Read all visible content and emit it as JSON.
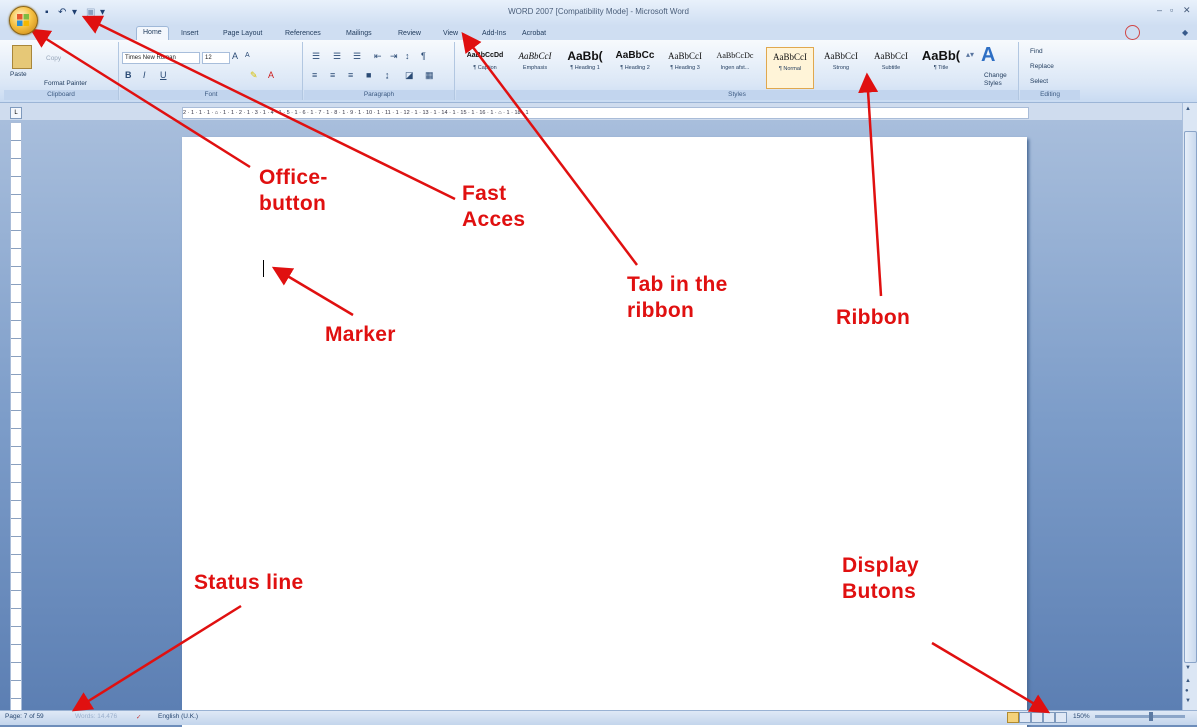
{
  "window": {
    "title": "WORD 2007 [Compatibility Mode] - Microsoft Word",
    "controls": [
      "–",
      "▫",
      "✕"
    ]
  },
  "quick_access": {
    "save": "💾",
    "undo": "↶",
    "redo": "▾",
    "customize": "▾"
  },
  "tabs": [
    {
      "label": "Home"
    },
    {
      "label": "Insert"
    },
    {
      "label": "Page Layout"
    },
    {
      "label": "References"
    },
    {
      "label": "Mailings"
    },
    {
      "label": "Review"
    },
    {
      "label": "View"
    },
    {
      "label": "Add-Ins"
    },
    {
      "label": "Acrobat"
    }
  ],
  "ribbon": {
    "clipboard": {
      "paste": "Paste",
      "cut": "Cut",
      "copy": "Copy",
      "format_painter": "Format Painter",
      "label": "Clipboard"
    },
    "font": {
      "name": "Times New Roman",
      "size": "12",
      "label": "Font"
    },
    "paragraph": {
      "label": "Paragraph"
    },
    "styles": {
      "label": "Styles",
      "items": [
        {
          "preview": "AaBbCcDd",
          "name": "¶ Caption"
        },
        {
          "preview": "AaBbCcI",
          "name": "Emphasis"
        },
        {
          "preview": "AaBb(",
          "name": "¶ Heading 1"
        },
        {
          "preview": "AaBbCc",
          "name": "¶ Heading 2"
        },
        {
          "preview": "AaBbCcI",
          "name": "¶ Heading 3"
        },
        {
          "preview": "AaBbCcDc",
          "name": "Ingen afst..."
        },
        {
          "preview": "AaBbCcI",
          "name": "¶ Normal"
        },
        {
          "preview": "AaBbCcI",
          "name": "Strong"
        },
        {
          "preview": "AaBbCcI",
          "name": "Subtitle"
        },
        {
          "preview": "AaBb(",
          "name": "¶ Title"
        }
      ],
      "change_styles": "Change Styles"
    },
    "editing": {
      "find": "Find",
      "replace": "Replace",
      "select": "Select",
      "label": "Editing"
    }
  },
  "ruler": {
    "text": "2 · 1 · 1 · 1 · ⌂ · 1 · 1 · 2 · 1 · 3 · 1 · 4 · 1 · 5 · 1 · 6 · 1 · 7 · 1 · 8 · 1 · 9 · 1 · 10 · 1 · 11 · 1 · 12 · 1 · 13 · 1 · 14 · 1 · 15 · 1 · 16 · 1 · ⌂ · 1 · 18 · 1"
  },
  "status": {
    "page": "Page: 7 of 59",
    "words": "Words: 14.476",
    "language": "English (U.K.)",
    "zoom": "150%"
  },
  "annotations": {
    "office_button": "Office-\nbutton",
    "fast_access": "Fast\nAcces",
    "tab_in_ribbon": "Tab in the\nribbon",
    "ribbon": "Ribbon",
    "marker": "Marker",
    "status_line": "Status line",
    "display_buttons": "Display\nButons"
  },
  "colors": {
    "annotation": "#e01010",
    "frame": "#cfdef2",
    "doc_bg": "#7d9dc9"
  }
}
